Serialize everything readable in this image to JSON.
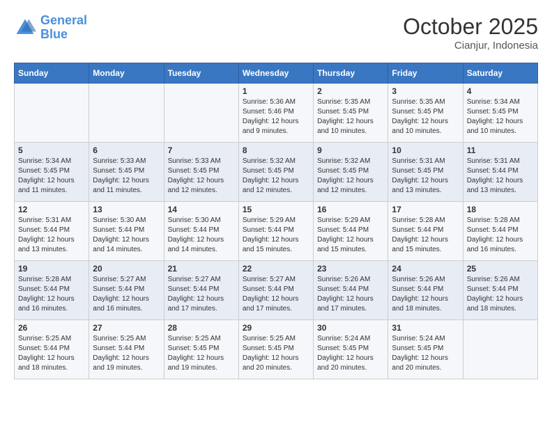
{
  "header": {
    "logo_general": "General",
    "logo_blue": "Blue",
    "month": "October 2025",
    "location": "Cianjur, Indonesia"
  },
  "days_of_week": [
    "Sunday",
    "Monday",
    "Tuesday",
    "Wednesday",
    "Thursday",
    "Friday",
    "Saturday"
  ],
  "weeks": [
    [
      {
        "day": "",
        "info": ""
      },
      {
        "day": "",
        "info": ""
      },
      {
        "day": "",
        "info": ""
      },
      {
        "day": "1",
        "info": "Sunrise: 5:36 AM\nSunset: 5:46 PM\nDaylight: 12 hours\nand 9 minutes."
      },
      {
        "day": "2",
        "info": "Sunrise: 5:35 AM\nSunset: 5:45 PM\nDaylight: 12 hours\nand 10 minutes."
      },
      {
        "day": "3",
        "info": "Sunrise: 5:35 AM\nSunset: 5:45 PM\nDaylight: 12 hours\nand 10 minutes."
      },
      {
        "day": "4",
        "info": "Sunrise: 5:34 AM\nSunset: 5:45 PM\nDaylight: 12 hours\nand 10 minutes."
      }
    ],
    [
      {
        "day": "5",
        "info": "Sunrise: 5:34 AM\nSunset: 5:45 PM\nDaylight: 12 hours\nand 11 minutes."
      },
      {
        "day": "6",
        "info": "Sunrise: 5:33 AM\nSunset: 5:45 PM\nDaylight: 12 hours\nand 11 minutes."
      },
      {
        "day": "7",
        "info": "Sunrise: 5:33 AM\nSunset: 5:45 PM\nDaylight: 12 hours\nand 12 minutes."
      },
      {
        "day": "8",
        "info": "Sunrise: 5:32 AM\nSunset: 5:45 PM\nDaylight: 12 hours\nand 12 minutes."
      },
      {
        "day": "9",
        "info": "Sunrise: 5:32 AM\nSunset: 5:45 PM\nDaylight: 12 hours\nand 12 minutes."
      },
      {
        "day": "10",
        "info": "Sunrise: 5:31 AM\nSunset: 5:45 PM\nDaylight: 12 hours\nand 13 minutes."
      },
      {
        "day": "11",
        "info": "Sunrise: 5:31 AM\nSunset: 5:44 PM\nDaylight: 12 hours\nand 13 minutes."
      }
    ],
    [
      {
        "day": "12",
        "info": "Sunrise: 5:31 AM\nSunset: 5:44 PM\nDaylight: 12 hours\nand 13 minutes."
      },
      {
        "day": "13",
        "info": "Sunrise: 5:30 AM\nSunset: 5:44 PM\nDaylight: 12 hours\nand 14 minutes."
      },
      {
        "day": "14",
        "info": "Sunrise: 5:30 AM\nSunset: 5:44 PM\nDaylight: 12 hours\nand 14 minutes."
      },
      {
        "day": "15",
        "info": "Sunrise: 5:29 AM\nSunset: 5:44 PM\nDaylight: 12 hours\nand 15 minutes."
      },
      {
        "day": "16",
        "info": "Sunrise: 5:29 AM\nSunset: 5:44 PM\nDaylight: 12 hours\nand 15 minutes."
      },
      {
        "day": "17",
        "info": "Sunrise: 5:28 AM\nSunset: 5:44 PM\nDaylight: 12 hours\nand 15 minutes."
      },
      {
        "day": "18",
        "info": "Sunrise: 5:28 AM\nSunset: 5:44 PM\nDaylight: 12 hours\nand 16 minutes."
      }
    ],
    [
      {
        "day": "19",
        "info": "Sunrise: 5:28 AM\nSunset: 5:44 PM\nDaylight: 12 hours\nand 16 minutes."
      },
      {
        "day": "20",
        "info": "Sunrise: 5:27 AM\nSunset: 5:44 PM\nDaylight: 12 hours\nand 16 minutes."
      },
      {
        "day": "21",
        "info": "Sunrise: 5:27 AM\nSunset: 5:44 PM\nDaylight: 12 hours\nand 17 minutes."
      },
      {
        "day": "22",
        "info": "Sunrise: 5:27 AM\nSunset: 5:44 PM\nDaylight: 12 hours\nand 17 minutes."
      },
      {
        "day": "23",
        "info": "Sunrise: 5:26 AM\nSunset: 5:44 PM\nDaylight: 12 hours\nand 17 minutes."
      },
      {
        "day": "24",
        "info": "Sunrise: 5:26 AM\nSunset: 5:44 PM\nDaylight: 12 hours\nand 18 minutes."
      },
      {
        "day": "25",
        "info": "Sunrise: 5:26 AM\nSunset: 5:44 PM\nDaylight: 12 hours\nand 18 minutes."
      }
    ],
    [
      {
        "day": "26",
        "info": "Sunrise: 5:25 AM\nSunset: 5:44 PM\nDaylight: 12 hours\nand 18 minutes."
      },
      {
        "day": "27",
        "info": "Sunrise: 5:25 AM\nSunset: 5:44 PM\nDaylight: 12 hours\nand 19 minutes."
      },
      {
        "day": "28",
        "info": "Sunrise: 5:25 AM\nSunset: 5:45 PM\nDaylight: 12 hours\nand 19 minutes."
      },
      {
        "day": "29",
        "info": "Sunrise: 5:25 AM\nSunset: 5:45 PM\nDaylight: 12 hours\nand 20 minutes."
      },
      {
        "day": "30",
        "info": "Sunrise: 5:24 AM\nSunset: 5:45 PM\nDaylight: 12 hours\nand 20 minutes."
      },
      {
        "day": "31",
        "info": "Sunrise: 5:24 AM\nSunset: 5:45 PM\nDaylight: 12 hours\nand 20 minutes."
      },
      {
        "day": "",
        "info": ""
      }
    ]
  ]
}
